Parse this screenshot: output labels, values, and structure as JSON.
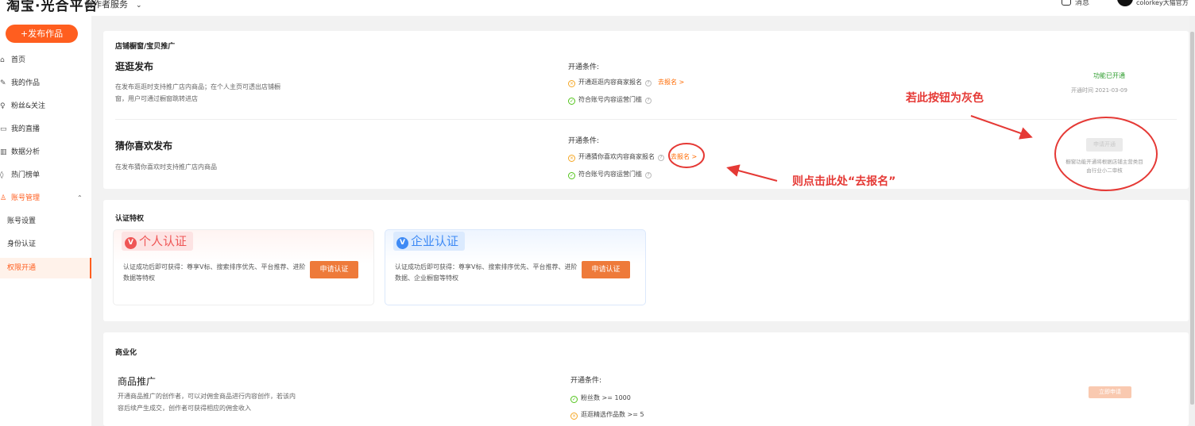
{
  "header": {
    "logo": "淘宝·光合平台",
    "service": "创作者服务",
    "message": "消息",
    "username": "colorkey大猫官方"
  },
  "sidebar": {
    "publish": "+发布作品",
    "items": [
      {
        "label": "首页",
        "icon": "⌂"
      },
      {
        "label": "我的作品",
        "icon": "✎"
      },
      {
        "label": "粉丝&关注",
        "icon": "♀"
      },
      {
        "label": "我的直播",
        "icon": "▭"
      },
      {
        "label": "数据分析",
        "icon": "▥"
      },
      {
        "label": "热门榜单",
        "icon": "◊"
      },
      {
        "label": "账号管理",
        "icon": "♙"
      }
    ],
    "subitems": [
      "账号设置",
      "身份认证",
      "权限开通"
    ]
  },
  "store": {
    "section_title": "店铺橱窗/宝贝推广",
    "guang": {
      "title": "逛逛发布",
      "desc": "在发布逛逛时支持推广店内商品；在个人主页可透出店铺橱窗，用户可通过橱窗跳转进店",
      "cond_label": "开通条件:",
      "cond1": "开通逛逛内容商家报名",
      "cond1_link": "去报名 >",
      "cond2": "符合账号内容运营门槛",
      "status": "功能已开通",
      "time": "开通时间 2021-03-09"
    },
    "guess": {
      "title": "猜你喜欢发布",
      "desc": "在发布猜你喜欢时支持推广店内商品",
      "cond_label": "开通条件:",
      "cond1": "开通猜你喜欢内容商家报名",
      "cond1_link": "去报名 >",
      "cond2": "符合账号内容运营门槛",
      "button": "申请开通",
      "tip": "橱窗功能开通将根据店铺主营类目由行业小二审核"
    }
  },
  "annotations": {
    "top": "若此按钮为灰色",
    "bottom": "则点击此处“去报名”"
  },
  "cert": {
    "section_title": "认证特权",
    "personal": {
      "tag": "个人认证",
      "badge": "V",
      "desc": "认证成功后即可获得：尊享V标、搜索排序优先、平台推荐、进阶数据等特权",
      "button": "申请认证"
    },
    "enterprise": {
      "tag": "企业认证",
      "badge": "V",
      "desc": "认证成功后即可获得：尊享V标、搜索排序优先、平台推荐、进阶数据、企业橱窗等特权",
      "button": "申请认证"
    }
  },
  "commerce": {
    "section_title": "商业化",
    "promo": {
      "title": "商品推广",
      "desc": "开通商品推广的创作者，可以对佣金商品进行内容创作，若该内容后续产生成交，创作者可获得相应的佣金收入",
      "cond_label": "开通条件:",
      "cond1": "粉丝数 >= 1000",
      "cond2": "逛逛精选作品数 >= 5",
      "button": "立即申请"
    }
  },
  "colors": {
    "accent": "#ff5e1f",
    "annotation": "#e53935",
    "personal": "#ef5555",
    "enterprise": "#3e8af5"
  }
}
